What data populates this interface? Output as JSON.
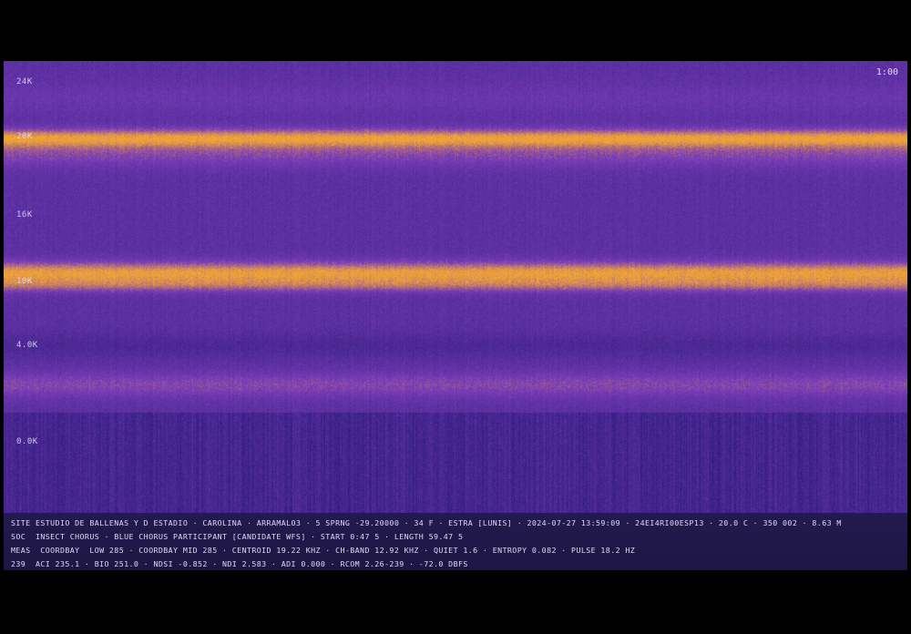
{
  "viewer": {
    "zoom_label": "1:00"
  },
  "frequency_axis": {
    "labels": [
      "24K",
      "20K",
      "16K",
      "10K",
      "4.0K",
      "0.0K"
    ]
  },
  "colormap": {
    "low": "#2a1a7a",
    "mid": "#7a3db8",
    "high": "#f0a437"
  },
  "info_panel": {
    "lines": [
      "SITE ESTUDIO DE BALLENAS Y D ESTADIO · CAROLINA · ARRAMAL03 · 5 SPRNG ·29.20000 · 34 F · ESTRA [LUNIS] · 2024-07-27 13:59:09 · 24EI4RI00ESP13 · 20.0 C · 350 002 · 8.63 M",
      "SOC  INSECT CHORUS · BLUE CHORUS PARTICIPANT [CANDIDATE WFS] · START 0:47 5 · LENGTH 59.47 5",
      "MEAS  COORDBAY  LOW 285 · COORDBAY MID 285 · CENTROID 19.22 KHZ · CH-BAND 12.92 KHZ · QUIET 1.6 · ENTROPY 0.082 · PULSE 18.2 HZ",
      "239  ACI 235.1 · BIO 251.0 · NDSI -0.852 · NDI 2.583 · ADI 0.000 · RCOM 2.26-239 · -72.0 DBFS"
    ]
  }
}
